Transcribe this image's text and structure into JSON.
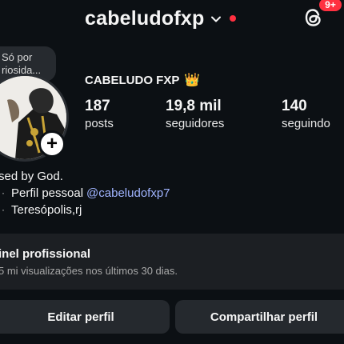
{
  "header": {
    "username": "cabeludofxp",
    "notification_count": "9+"
  },
  "note": {
    "line1": "Só por",
    "line2": "riosida..."
  },
  "profile": {
    "display_name": "CABELUDO FXP",
    "crown_emoji": "👑",
    "add_story_symbol": "+"
  },
  "stats": [
    {
      "value": "187",
      "label": "posts"
    },
    {
      "value": "19,8 mil",
      "label": "seguidores"
    },
    {
      "value": "140",
      "label": "seguindo"
    }
  ],
  "bio": {
    "line1": "sed by God.",
    "line2_prefix": "Perfil pessoal",
    "line2_mention": "@cabeludofxp7",
    "line3": "Teresópolis,rj"
  },
  "professional_panel": {
    "title": "inel profissional",
    "subtitle": "5 mi visualizações nos últimos 30 dias."
  },
  "actions": {
    "edit_profile": "Editar perfil",
    "share_profile": "Compartilhar perfil"
  },
  "colors": {
    "background": "#0c1014",
    "badge": "#ff3040",
    "mention": "#a0b4ff",
    "button": "#25292e"
  }
}
